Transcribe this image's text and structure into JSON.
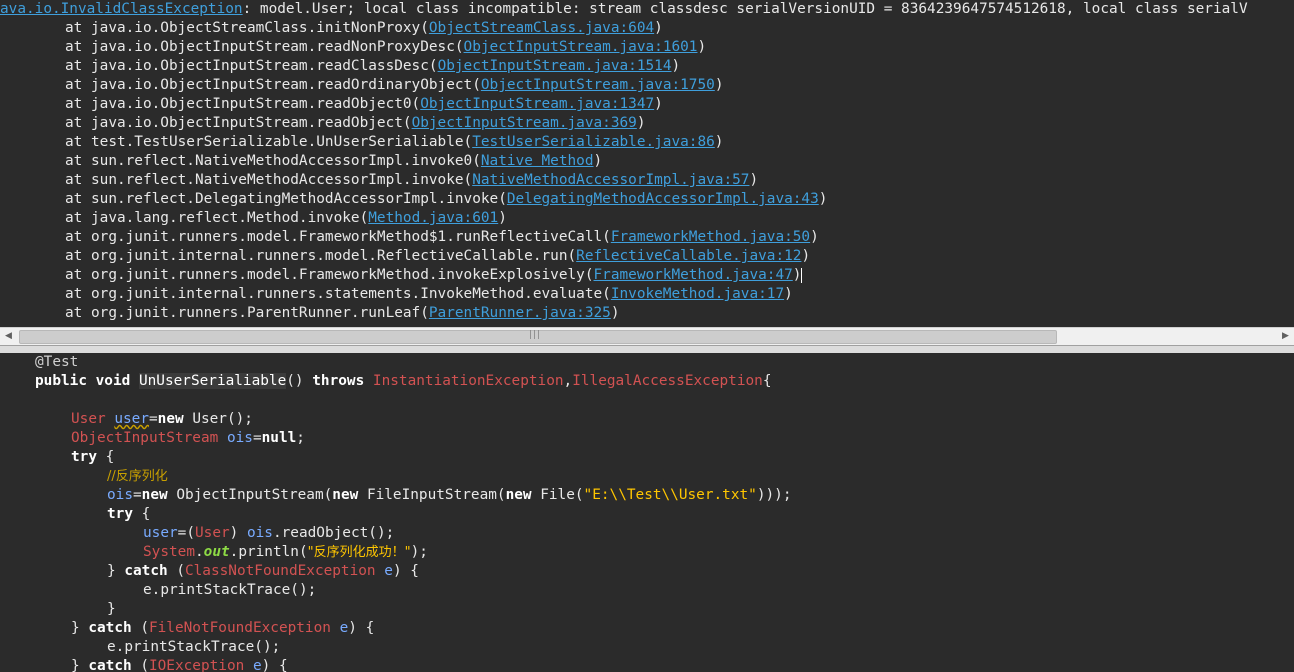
{
  "console": {
    "first": {
      "exception": "ava.io.InvalidClassException",
      "message": ": model.User; local class incompatible: stream classdesc serialVersionUID = 8364239647574512618, local class serialV"
    },
    "frames": [
      {
        "method": "at java.io.ObjectStreamClass.initNonProxy(",
        "link": "ObjectStreamClass.java:604",
        "close": ")"
      },
      {
        "method": "at java.io.ObjectInputStream.readNonProxyDesc(",
        "link": "ObjectInputStream.java:1601",
        "close": ")"
      },
      {
        "method": "at java.io.ObjectInputStream.readClassDesc(",
        "link": "ObjectInputStream.java:1514",
        "close": ")"
      },
      {
        "method": "at java.io.ObjectInputStream.readOrdinaryObject(",
        "link": "ObjectInputStream.java:1750",
        "close": ")"
      },
      {
        "method": "at java.io.ObjectInputStream.readObject0(",
        "link": "ObjectInputStream.java:1347",
        "close": ")"
      },
      {
        "method": "at java.io.ObjectInputStream.readObject(",
        "link": "ObjectInputStream.java:369",
        "close": ")"
      },
      {
        "method": "at test.TestUserSerializable.UnUserSerialiable(",
        "link": "TestUserSerializable.java:86",
        "close": ")"
      },
      {
        "method": "at sun.reflect.NativeMethodAccessorImpl.invoke0(",
        "link": "Native Method",
        "close": ")"
      },
      {
        "method": "at sun.reflect.NativeMethodAccessorImpl.invoke(",
        "link": "NativeMethodAccessorImpl.java:57",
        "close": ")"
      },
      {
        "method": "at sun.reflect.DelegatingMethodAccessorImpl.invoke(",
        "link": "DelegatingMethodAccessorImpl.java:43",
        "close": ")"
      },
      {
        "method": "at java.lang.reflect.Method.invoke(",
        "link": "Method.java:601",
        "close": ")"
      },
      {
        "method": "at org.junit.runners.model.FrameworkMethod$1.runReflectiveCall(",
        "link": "FrameworkMethod.java:50",
        "close": ")"
      },
      {
        "method": "at org.junit.internal.runners.model.ReflectiveCallable.run(",
        "link": "ReflectiveCallable.java:12",
        "close": ")"
      },
      {
        "method": "at org.junit.runners.model.FrameworkMethod.invokeExplosively(",
        "link": "FrameworkMethod.java:47",
        "close": ")"
      },
      {
        "method": "at org.junit.internal.runners.statements.InvokeMethod.evaluate(",
        "link": "InvokeMethod.java:17",
        "close": ")"
      },
      {
        "method": "at org.junit.runners.ParentRunner.runLeaf(",
        "link": "ParentRunner.java:325",
        "close": ")"
      }
    ]
  },
  "scrollbar": {
    "left_arrow": "◀",
    "right_arrow": "▶",
    "grip": "|||"
  },
  "code": {
    "annotation": "@Test",
    "kw_public_void": "public void ",
    "method_name": "UnUserSerialiable",
    "parens": "() ",
    "kw_throws": "throws ",
    "exc1": "InstantiationException",
    "comma": ",",
    "exc2": "IllegalAccessException",
    "open_brace": "{",
    "type_user": "User ",
    "var_user": "user",
    "eq": "=",
    "kw_new": "new ",
    "user_ctor": "User();",
    "type_ois": "ObjectInputStream ",
    "var_ois": "ois",
    "kw_null": "null",
    "semicolon": ";",
    "kw_try": "try",
    "brace_open_sp": " {",
    "comment": "//反序列化",
    "ois_ctor": "ObjectInputStream(",
    "fis_ctor": "FileInputStream(",
    "file_ctor": "File(",
    "path_string": "\"E:\\\\Test\\\\User.txt\"",
    "close_parens": ")));",
    "cast_open": "(",
    "cast_type": "User",
    "cast_close": ") ",
    "read_object": ".readObject();",
    "system": "System",
    "dot": ".",
    "out": "out",
    "println_open": ".println(",
    "success_string": "\"反序列化成功！\"",
    "println_close": ");",
    "close_brace": "} ",
    "kw_catch": "catch",
    "catch_open": " (",
    "cnfe": "ClassNotFoundException",
    "fnfe": "FileNotFoundException",
    "ioe": "IOException",
    "var_e": "e",
    "catch_close": ") {",
    "e_var": "e",
    "print_stack": ".printStackTrace();",
    "lone_close_brace": "}"
  }
}
